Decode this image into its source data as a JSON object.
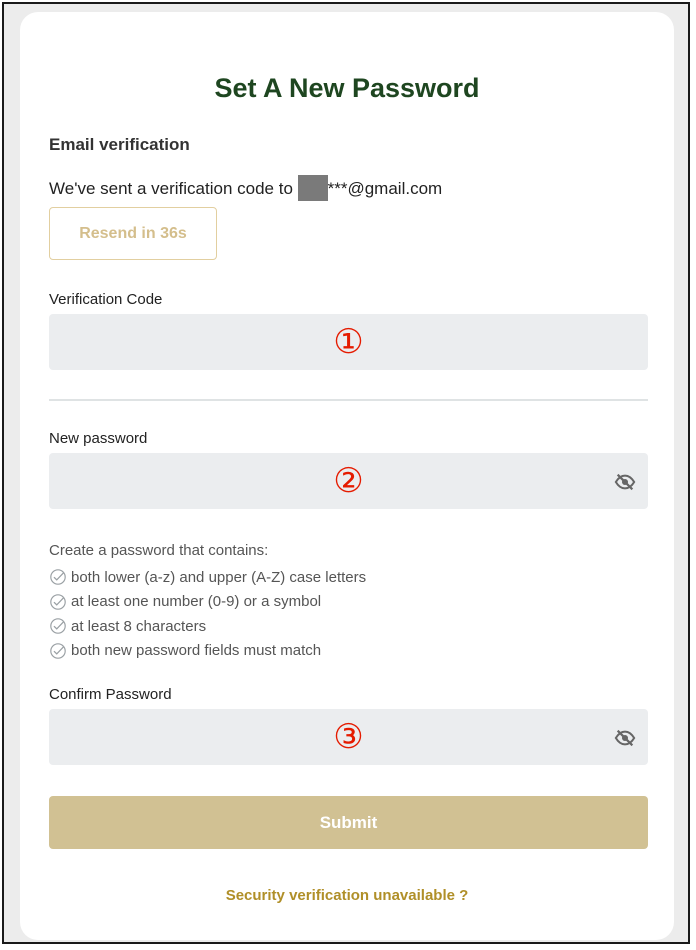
{
  "page": {
    "title": "Set A New Password"
  },
  "email_section": {
    "heading": "Email verification",
    "sent_prefix": "We've sent a verification code to ",
    "email_suffix": "***@gmail.com",
    "resend_label": "Resend in 36s"
  },
  "verification_code": {
    "label": "Verification Code",
    "value": "",
    "marker": "①"
  },
  "new_password": {
    "label": "New password",
    "value": "",
    "marker": "②",
    "toggle_icon": "eye-off-icon"
  },
  "requirements": {
    "intro": "Create a password that contains:",
    "items": [
      "both lower (a-z) and upper (A-Z) case letters",
      "at least one number (0-9) or a symbol",
      "at least 8 characters",
      "both new password fields must match"
    ],
    "icon": "check-circle-icon"
  },
  "confirm_password": {
    "label": "Confirm Password",
    "value": "",
    "marker": "③",
    "toggle_icon": "eye-off-icon"
  },
  "submit": {
    "label": "Submit"
  },
  "help_link": {
    "label": "Security verification unavailable ?"
  },
  "colors": {
    "title": "#1e4620",
    "accent_gold": "#d1c193",
    "link_gold": "#b08f28",
    "input_bg": "#ebedef",
    "marker_red": "#e51b00"
  }
}
